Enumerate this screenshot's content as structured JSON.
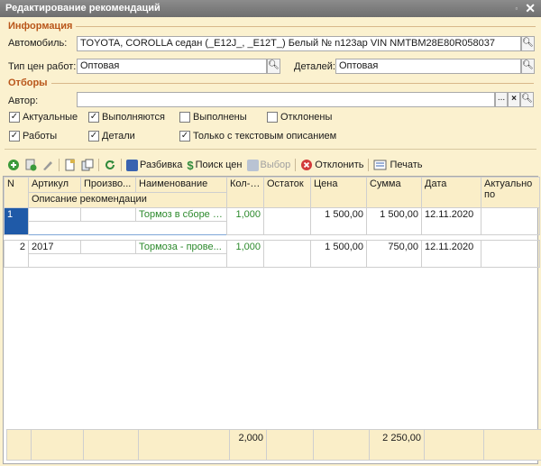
{
  "window": {
    "title": "Редактирование рекомендаций",
    "restore_glyph": "▫",
    "close_glyph": "✕"
  },
  "info": {
    "heading": "Информация",
    "car_label": "Автомобиль:",
    "car_value": "TOYOTA, COROLLA седан (_E12J_, _E12T_) Белый № n123ap VIN NMTBM28E80R058037",
    "price_type_label": "Тип цен работ:",
    "price_type_value": "Оптовая",
    "parts_label": "Деталей:",
    "parts_value": "Оптовая"
  },
  "filters": {
    "heading": "Отборы",
    "author_label": "Автор:",
    "author_value": "",
    "checkboxes": [
      {
        "label": "Актуальные",
        "checked": true
      },
      {
        "label": "Выполняются",
        "checked": true
      },
      {
        "label": "Выполнены",
        "checked": false
      },
      {
        "label": "Отклонены",
        "checked": false
      },
      {
        "label": "Работы",
        "checked": true
      },
      {
        "label": "Детали",
        "checked": true
      },
      {
        "label": "Только с текстовым описанием",
        "checked": true
      }
    ]
  },
  "toolbar": {
    "split_label": "Разбивка",
    "price_search_label": "Поиск цен",
    "choose_label": "Выбор",
    "reject_label": "Отклонить",
    "print_label": "Печать"
  },
  "table": {
    "columns": [
      "N",
      "Артикул",
      "Произво...",
      "Наименование",
      "Кол-во",
      "Остаток",
      "Цена",
      "Сумма",
      "Дата",
      "Актуально по"
    ],
    "subheader": "Описание рекомендации",
    "rows": [
      {
        "n": "1",
        "article": "",
        "maker": "",
        "name": "Тормоз в сборе -...",
        "qty": "1,000",
        "rest": "",
        "price": "1 500,00",
        "sum": "1 500,00",
        "date": "12.11.2020",
        "actual": ""
      },
      {
        "n": "2",
        "article": "2017",
        "maker": "",
        "name": "Тормоза - прове...",
        "qty": "1,000",
        "rest": "",
        "price": "1 500,00",
        "sum": "750,00",
        "date": "12.11.2020",
        "actual": ""
      }
    ],
    "totals": {
      "qty": "2,000",
      "sum": "2 250,00"
    }
  },
  "colors": {
    "background": "#fbf1cf",
    "section": "#b9561a",
    "selection": "#1f5aa8",
    "green_text": "#2d8a2d"
  }
}
